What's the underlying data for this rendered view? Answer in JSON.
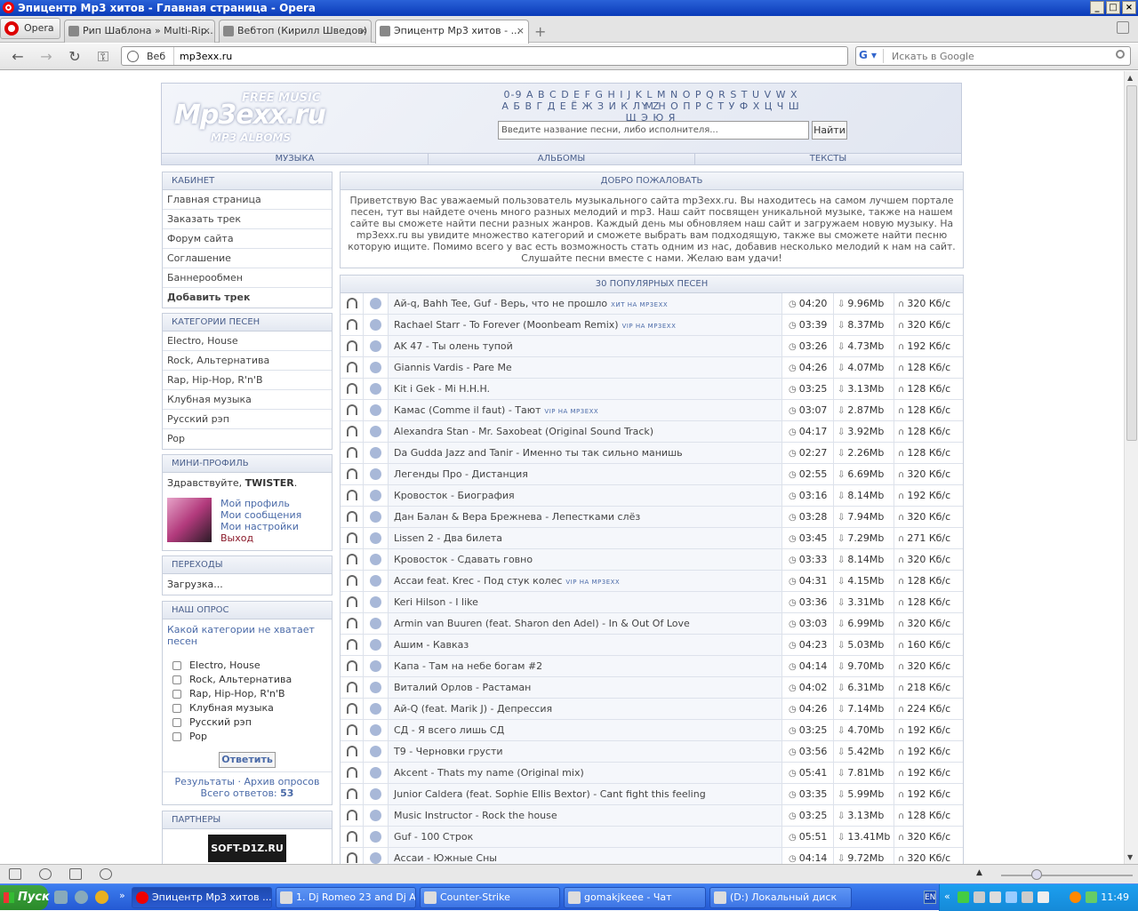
{
  "window": {
    "title": "Эпицентр Mp3 хитов - Главная страница - Opera"
  },
  "browser": {
    "menu_label": "Opera",
    "tabs": [
      {
        "label": "Рип Шаблона » Multi-Rip..."
      },
      {
        "label": "Вебтоп (Кирилл Шведов)"
      },
      {
        "label": "Эпицентр Mp3 хитов - ..."
      }
    ],
    "address_prefix": "Веб",
    "url": "mp3exx.ru",
    "search_placeholder": "Искать в Google"
  },
  "site": {
    "logo_top": "FREE MUSIC",
    "logo_main": "Mp3exx.ru",
    "logo_bottom": "MP3 ALBOMS",
    "alphabet_latin": "0-9 A B C D E F G H I J K L M N O P Q R S T U V W X Y Z",
    "alphabet_cyr": "А Б В Г Д Е Ё Ж З И К Л М Н О П Р С Т У Ф Х Ц Ч Ш Щ Э Ю Я",
    "search_placeholder": "Введите название песни, либо исполнителя...",
    "search_button": "Найти",
    "nav": [
      "МУЗЫКА",
      "АЛЬБОМЫ",
      "ТЕКСТЫ"
    ]
  },
  "sidebar": {
    "cabinet": {
      "title": "КАБИНЕТ",
      "items": [
        "Главная страница",
        "Заказать трек",
        "Форум сайта",
        "Соглашение",
        "Баннерообмен",
        "Добавить трек"
      ]
    },
    "categories": {
      "title": "КАТЕГОРИИ ПЕСЕН",
      "items": [
        "Electro, House",
        "Rock, Альтернатива",
        "Rap, Hip-Hop, R'n'B",
        "Клубная музыка",
        "Русский рэп",
        "Pop"
      ]
    },
    "profile": {
      "title": "МИНИ-ПРОФИЛЬ",
      "greeting": "Здравствуйте,",
      "username": "TWISTER",
      "links": [
        "Мой профиль",
        "Мои сообщения",
        "Мои настройки"
      ],
      "logout": "Выход"
    },
    "transitions": {
      "title": "ПЕРЕХОДЫ",
      "text": "Загрузка..."
    },
    "poll": {
      "title": "НАШ ОПРОС",
      "question": "Какой категории не хватает песен",
      "options": [
        "Electro, House",
        "Rock, Альтернатива",
        "Rap, Hip-Hop, R'n'B",
        "Клубная музыка",
        "Русский рэп",
        "Pop"
      ],
      "button": "Ответить",
      "results": "Результаты",
      "archive": "Архив опросов",
      "total_label": "Всего ответов:",
      "total": "53"
    },
    "partners": {
      "title": "ПАРТНЕРЫ",
      "banner": "SOFT-D1Z.RU"
    }
  },
  "welcome": {
    "title": "ДОБРО ПОЖАЛОВАТЬ",
    "text": "Приветствую Вас уважаемый пользователь музыкального сайта mp3exx.ru. Вы находитесь на самом лучшем портале песен, тут вы найдете очень много разных мелодий и mp3. Наш сайт посвящен уникальной музыке, также на нашем сайте вы сможете найти песни разных жанров. Каждый день мы обновляем наш сайт и загружаем новую музыку. На mp3exx.ru вы увидите множество категорий и сможете выбрать вам подходящую, также вы сможете найти песню которую ищите. Помимо всего у вас есть возможность стать одним из нас, добавив несколько мелодий к нам на сайт. Слушайте песни вместе с нами. Желаю вам удачи!"
  },
  "songs": {
    "title": "30 ПОПУЛЯРНЫХ ПЕСЕН",
    "rows": [
      {
        "name": "Ай-q, Bahh Tee, Guf - Верь, что не прошло",
        "tag": "ХИТ НА MP3EXX",
        "dur": "04:20",
        "size": "9.96Mb",
        "rate": "320 Кб/с"
      },
      {
        "name": "Rachael Starr - To Forever (Moonbeam Remix)",
        "tag": "VIP НА MP3EXX",
        "dur": "03:39",
        "size": "8.37Mb",
        "rate": "320 Кб/с"
      },
      {
        "name": "AK 47 - Ты олень тупой",
        "tag": "",
        "dur": "03:26",
        "size": "4.73Mb",
        "rate": "192 Кб/с"
      },
      {
        "name": "Giannis Vardis - Pare Me",
        "tag": "",
        "dur": "04:26",
        "size": "4.07Mb",
        "rate": "128 Кб/с"
      },
      {
        "name": "Kit i Gek - Mi H.H.H.",
        "tag": "",
        "dur": "03:25",
        "size": "3.13Mb",
        "rate": "128 Кб/с"
      },
      {
        "name": "Камас (Comme il faut) - Тают",
        "tag": "VIP НА MP3EXX",
        "dur": "03:07",
        "size": "2.87Mb",
        "rate": "128 Кб/с"
      },
      {
        "name": "Alexandra Stan - Mr. Saxobeat (Original Sound Track)",
        "tag": "",
        "dur": "04:17",
        "size": "3.92Mb",
        "rate": "128 Кб/с"
      },
      {
        "name": "Da Gudda Jazz and Tanir - Именно ты так сильно манишь",
        "tag": "",
        "dur": "02:27",
        "size": "2.26Mb",
        "rate": "128 Кб/с"
      },
      {
        "name": "Легенды Про - Дистанция",
        "tag": "",
        "dur": "02:55",
        "size": "6.69Mb",
        "rate": "320 Кб/с"
      },
      {
        "name": "Кровосток - Биография",
        "tag": "",
        "dur": "03:16",
        "size": "8.14Mb",
        "rate": "192 Кб/с"
      },
      {
        "name": "Дан Балан & Вера Брежнева - Лепестками слёз",
        "tag": "",
        "dur": "03:28",
        "size": "7.94Mb",
        "rate": "320 Кб/с"
      },
      {
        "name": "Lissen 2 - Два билета",
        "tag": "",
        "dur": "03:45",
        "size": "7.29Mb",
        "rate": "271 Кб/с"
      },
      {
        "name": "Кровосток - Сдавать говно",
        "tag": "",
        "dur": "03:33",
        "size": "8.14Mb",
        "rate": "320 Кб/с"
      },
      {
        "name": "Ассаи feat. Krec - Под стук колес",
        "tag": "VIP НА MP3EXX",
        "dur": "04:31",
        "size": "4.15Mb",
        "rate": "128 Кб/с"
      },
      {
        "name": "Keri Hilson - I like",
        "tag": "",
        "dur": "03:36",
        "size": "3.31Mb",
        "rate": "128 Кб/с"
      },
      {
        "name": "Armin van Buuren (feat. Sharon den Adel) - In & Out Of Love",
        "tag": "",
        "dur": "03:03",
        "size": "6.99Mb",
        "rate": "320 Кб/с"
      },
      {
        "name": "Ашим - Кавказ",
        "tag": "",
        "dur": "04:23",
        "size": "5.03Mb",
        "rate": "160 Кб/с"
      },
      {
        "name": "Капа - Там на небе богам #2",
        "tag": "",
        "dur": "04:14",
        "size": "9.70Mb",
        "rate": "320 Кб/с"
      },
      {
        "name": "Виталий Орлов - Растаман",
        "tag": "",
        "dur": "04:02",
        "size": "6.31Mb",
        "rate": "218 Кб/с"
      },
      {
        "name": "Ай-Q (feat. Marik J) - Депрессия",
        "tag": "",
        "dur": "04:26",
        "size": "7.14Mb",
        "rate": "224 Кб/с"
      },
      {
        "name": "СД - Я всего лишь СД",
        "tag": "",
        "dur": "03:25",
        "size": "4.70Mb",
        "rate": "192 Кб/с"
      },
      {
        "name": "T9 - Черновки грусти",
        "tag": "",
        "dur": "03:56",
        "size": "5.42Mb",
        "rate": "192 Кб/с"
      },
      {
        "name": "Akcent - Thats my name (Original mix)",
        "tag": "",
        "dur": "05:41",
        "size": "7.81Mb",
        "rate": "192 Кб/с"
      },
      {
        "name": "Junior Caldera (feat. Sophie Ellis Bextor) - Cant fight this feeling",
        "tag": "",
        "dur": "03:35",
        "size": "5.99Mb",
        "rate": "192 Кб/с"
      },
      {
        "name": "Music Instructor - Rock the house",
        "tag": "",
        "dur": "03:25",
        "size": "3.13Mb",
        "rate": "128 Кб/с"
      },
      {
        "name": "Guf - 100 Строк",
        "tag": "",
        "dur": "05:51",
        "size": "13.41Mb",
        "rate": "320 Кб/с"
      },
      {
        "name": "Ассаи - Южные Сны",
        "tag": "",
        "dur": "04:14",
        "size": "9.72Mb",
        "rate": "320 Кб/с"
      }
    ]
  },
  "taskbar": {
    "start": "Пуск",
    "items": [
      "Эпицентр Mp3 хитов ...",
      "1. Dj Romeo 23 and Dj A...",
      "Counter-Strike",
      "gomakjkeee - Чат",
      "(D:) Локальный диск"
    ],
    "lang": "EN",
    "clock": "11:49"
  }
}
